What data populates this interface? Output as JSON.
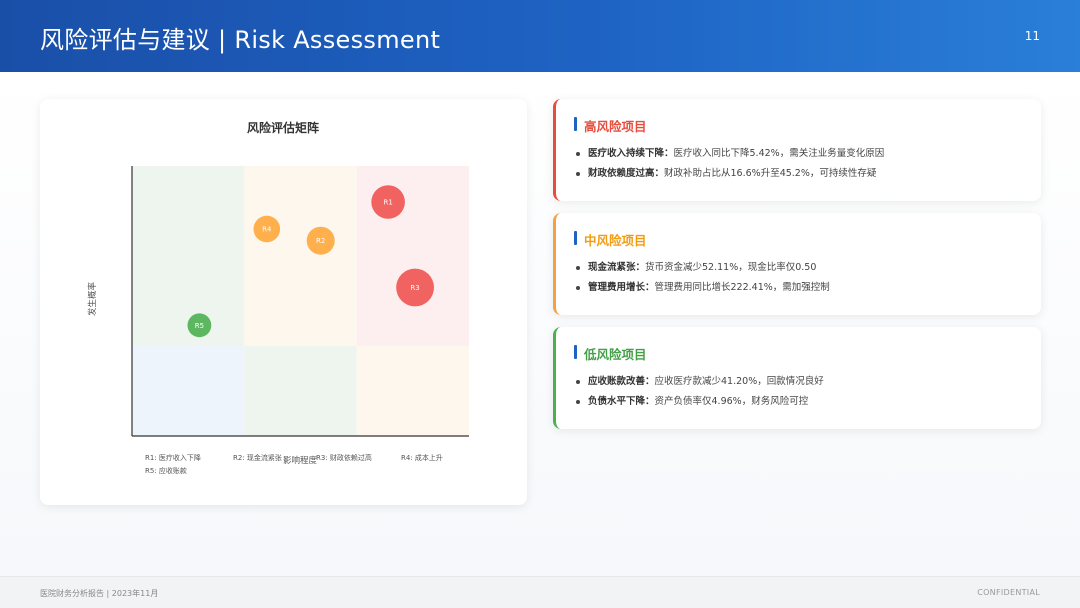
{
  "header": {
    "title": "风险评估与建议 | Risk Assessment",
    "page_number": "11"
  },
  "chart_data": {
    "type": "scatter",
    "title": "风险评估矩阵",
    "xlabel": "影响程度",
    "ylabel": "发生概率",
    "xlim": [
      0,
      3
    ],
    "ylim": [
      0,
      3
    ],
    "grid_cells": [
      {
        "col": 0,
        "row": 2,
        "color": "#eef5ee"
      },
      {
        "col": 1,
        "row": 2,
        "color": "#fdf7ee"
      },
      {
        "col": 2,
        "row": 2,
        "color": "#fdeff0"
      },
      {
        "col": 0,
        "row": 1,
        "color": "#eef5ee"
      },
      {
        "col": 1,
        "row": 1,
        "color": "#fdf7ee"
      },
      {
        "col": 2,
        "row": 1,
        "color": "#fdeff0"
      },
      {
        "col": 0,
        "row": 0,
        "color": "#eef4fb"
      },
      {
        "col": 1,
        "row": 0,
        "color": "#eef5ee"
      },
      {
        "col": 2,
        "row": 0,
        "color": "#fdf7ee"
      }
    ],
    "points": [
      {
        "label": "R1",
        "x": 2.28,
        "y": 2.6,
        "size": 1.2,
        "color": "#ef5350"
      },
      {
        "label": "R2",
        "x": 1.68,
        "y": 2.17,
        "size": 1.0,
        "color": "#ffa63a"
      },
      {
        "label": "R3",
        "x": 2.52,
        "y": 1.65,
        "size": 1.35,
        "color": "#ef5350"
      },
      {
        "label": "R4",
        "x": 1.2,
        "y": 2.3,
        "size": 0.95,
        "color": "#ffa63a"
      },
      {
        "label": "R5",
        "x": 0.6,
        "y": 1.23,
        "size": 0.85,
        "color": "#4caf50"
      }
    ],
    "legend": [
      "R1: 医疗收入下降",
      "R2: 现金流紧张",
      "R3: 财政依赖过高",
      "R4: 成本上升",
      "R5: 应收账款"
    ]
  },
  "risk_cards": [
    {
      "title": "高风险项目",
      "title_color": "#e74c3c",
      "border_color": "#e74c3c",
      "items": [
        {
          "label": "医疗收入持续下降：",
          "text": "医疗收入同比下降5.42%，需关注业务量变化原因"
        },
        {
          "label": "财政依赖度过高：",
          "text": "财政补助占比从16.6%升至45.2%，可持续性存疑"
        }
      ]
    },
    {
      "title": "中风险项目",
      "title_color": "#f39c12",
      "border_color": "#f5a043",
      "items": [
        {
          "label": "现金流紧张：",
          "text": "货币资金减少52.11%，现金比率仅0.50"
        },
        {
          "label": "管理费用增长：",
          "text": "管理费用同比增长222.41%，需加强控制"
        }
      ]
    },
    {
      "title": "低风险项目",
      "title_color": "#43a047",
      "border_color": "#4caf50",
      "items": [
        {
          "label": "应收账款改善：",
          "text": "应收医疗款减少41.20%，回款情况良好"
        },
        {
          "label": "负债水平下降：",
          "text": "资产负债率仅4.96%，财务风险可控"
        }
      ]
    }
  ],
  "footer": {
    "left_text": "医院财务分析报告 | 2023年11月",
    "right_text": "CONFIDENTIAL"
  }
}
